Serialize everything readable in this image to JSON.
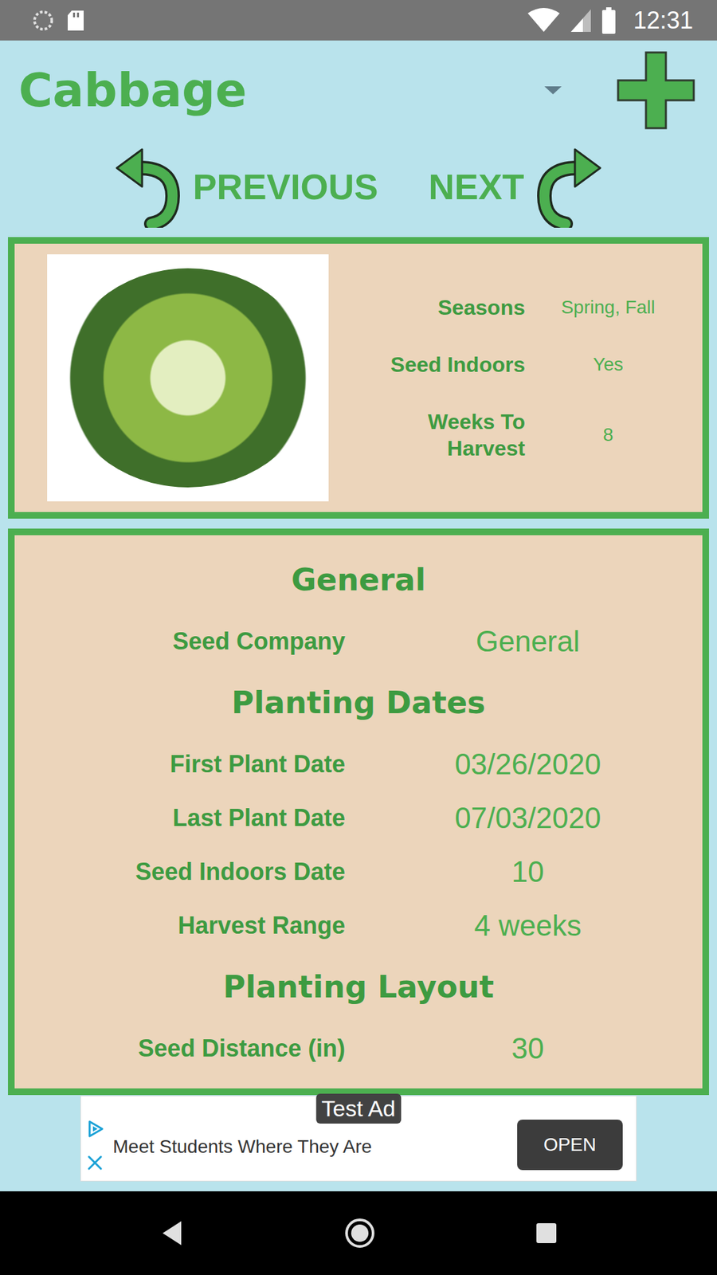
{
  "status_bar": {
    "time": "12:31"
  },
  "header": {
    "title": "Cabbage"
  },
  "nav": {
    "previous": "PREVIOUS",
    "next": "NEXT"
  },
  "summary": [
    {
      "label": "Seasons",
      "value": "Spring, Fall"
    },
    {
      "label": "Seed Indoors",
      "value": "Yes"
    },
    {
      "label": "Weeks To Harvest",
      "value": "8"
    }
  ],
  "sections": [
    {
      "title": "General",
      "rows": [
        {
          "label": "Seed Company",
          "value": "General"
        }
      ]
    },
    {
      "title": "Planting Dates",
      "rows": [
        {
          "label": "First Plant Date",
          "value": "03/26/2020"
        },
        {
          "label": "Last Plant Date",
          "value": "07/03/2020"
        },
        {
          "label": "Seed Indoors Date",
          "value": "10"
        },
        {
          "label": "Harvest Range",
          "value": "4 weeks"
        }
      ]
    },
    {
      "title": "Planting Layout",
      "rows": [
        {
          "label": "Seed Distance (in)",
          "value": "30"
        }
      ]
    }
  ],
  "ad": {
    "badge": "Test Ad",
    "text": "Meet Students Where They Are",
    "button": "OPEN"
  }
}
